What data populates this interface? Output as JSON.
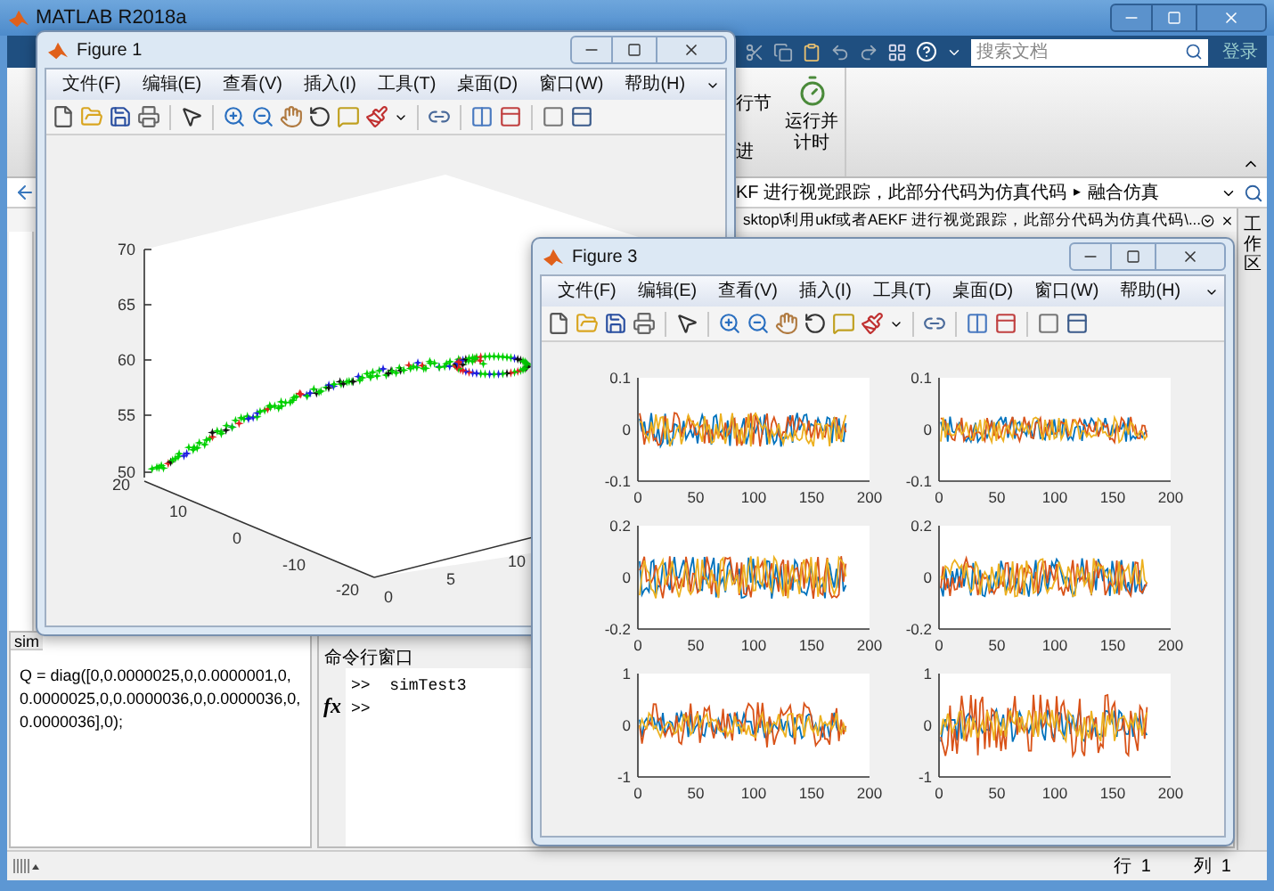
{
  "window": {
    "title": "MATLAB R2018a"
  },
  "search": {
    "placeholder": "搜索文档"
  },
  "login_button": "登录",
  "ribbon": {
    "run_section": "行节",
    "advance": "进",
    "run_and_time": "运行并计时"
  },
  "address_bar": {
    "path": "KF 进行视觉跟踪，此部分代码为仿真代码",
    "separator": "▸",
    "current": "融合仿真"
  },
  "file_path": "sktop\\利用ukf或者AEKF 进行视觉跟踪，此部分代码为仿真代码\\...",
  "side_tab": "工作区",
  "details_panel": {
    "tab": "sim",
    "text": "Q = diag([0,0.0000025,0,0.0000001,0,0.0000025,0,0.0000036,0,0.0000036,0,0.0000036],0);"
  },
  "command_window": {
    "title": "命令行窗口",
    "fx": "fx",
    "lines": [
      ">>  simTest3",
      ">>"
    ]
  },
  "status_bar": {
    "row": "行  1",
    "col": "列  1"
  },
  "figures": [
    {
      "title": "Figure 1",
      "kind": "trajectory",
      "menu": [
        "文件(F)",
        "编辑(E)",
        "查看(V)",
        "插入(I)",
        "工具(T)",
        "桌面(D)",
        "窗口(W)",
        "帮助(H)"
      ],
      "plot": {
        "z_ticks": [
          "70",
          "65",
          "60",
          "55",
          "50"
        ],
        "y_ticks": [
          "20",
          "10",
          "0",
          "-10",
          "-20"
        ],
        "x_ticks": [
          "0",
          "5",
          "10"
        ]
      }
    },
    {
      "title": "Figure 3",
      "kind": "grid",
      "menu": [
        "文件(F)",
        "编辑(E)",
        "查看(V)",
        "插入(I)",
        "工具(T)",
        "桌面(D)",
        "窗口(W)",
        "帮助(H)"
      ],
      "subplots": [
        {
          "yticks": [
            "0.1",
            "0",
            "-0.1"
          ],
          "xticks": [
            "0",
            "50",
            "100",
            "150",
            "200"
          ]
        },
        {
          "yticks": [
            "0.1",
            "0",
            "-0.1"
          ],
          "xticks": [
            "0",
            "50",
            "100",
            "150",
            "200"
          ]
        },
        {
          "yticks": [
            "0.2",
            "0",
            "-0.2"
          ],
          "xticks": [
            "0",
            "50",
            "100",
            "150",
            "200"
          ]
        },
        {
          "yticks": [
            "0.2",
            "0",
            "-0.2"
          ],
          "xticks": [
            "0",
            "50",
            "100",
            "150",
            "200"
          ]
        },
        {
          "yticks": [
            "1",
            "0",
            "-1"
          ],
          "xticks": [
            "0",
            "50",
            "100",
            "150",
            "200"
          ]
        },
        {
          "yticks": [
            "1",
            "0",
            "-1"
          ],
          "xticks": [
            "0",
            "50",
            "100",
            "150",
            "200"
          ]
        }
      ]
    }
  ]
}
